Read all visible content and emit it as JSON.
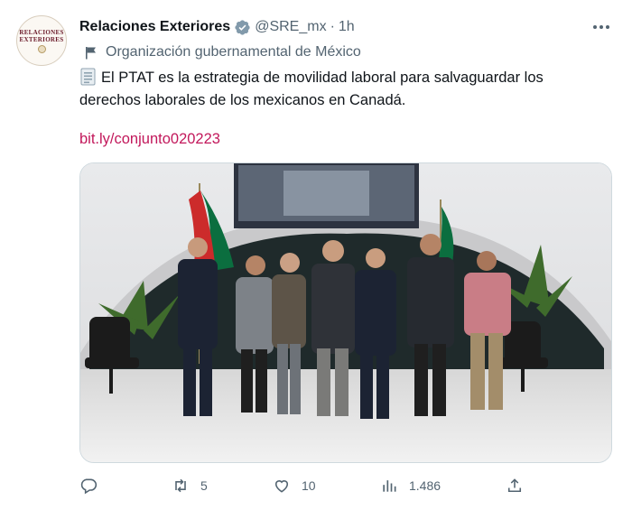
{
  "account": {
    "name": "Relaciones Exteriores",
    "handle": "@SRE_mx",
    "separator": "·",
    "time": "1h",
    "avatar_line1": "RELACIONES",
    "avatar_line2": "EXTERIORES",
    "affiliation": "Organización gubernamental de México"
  },
  "tweet": {
    "text": "El PTAT es la estrategia de movilidad laboral para salvaguardar los derechos laborales de los mexicanos en Canadá.",
    "link": "bit.ly/conjunto020223"
  },
  "actions": {
    "replies": "",
    "reposts": "5",
    "likes": "10",
    "views": "1.486"
  },
  "colors": {
    "link": "#c2185b",
    "verified": "#1d9bf0",
    "secondary_text": "#536471"
  },
  "icons": [
    "verified-badge-icon",
    "more-icon",
    "flag-icon",
    "memo-icon",
    "reply-icon",
    "repost-icon",
    "like-icon",
    "views-icon",
    "share-icon"
  ]
}
